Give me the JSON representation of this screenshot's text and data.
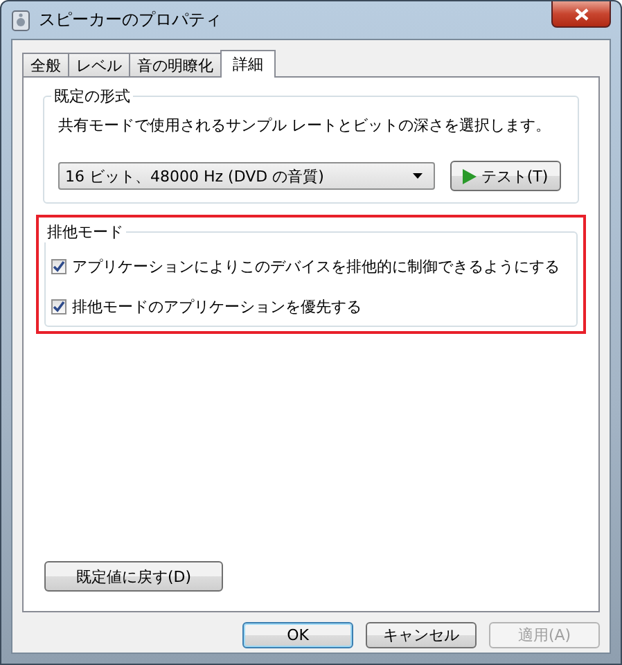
{
  "window": {
    "title": "スピーカーのプロパティ"
  },
  "tabs": [
    {
      "label": "全般",
      "selected": false
    },
    {
      "label": "レベル",
      "selected": false
    },
    {
      "label": "音の明瞭化",
      "selected": false
    },
    {
      "label": "詳細",
      "selected": true
    }
  ],
  "default_format": {
    "title": "既定の形式",
    "description": "共有モードで使用されるサンプル レートとビットの深さを選択します。",
    "dropdown_value": "16 ビット、48000 Hz (DVD の音質)",
    "test_button": "テスト(T)"
  },
  "exclusive_mode": {
    "title": "排他モード",
    "highlighted": true,
    "options": [
      {
        "label": "アプリケーションによりこのデバイスを排他的に制御できるようにする",
        "checked": true
      },
      {
        "label": "排他モードのアプリケーションを優先する",
        "checked": true
      }
    ]
  },
  "restore_button": "既定値に戻す(D)",
  "buttons": [
    {
      "label": "OK",
      "disabled": false,
      "default": true
    },
    {
      "label": "キャンセル",
      "disabled": false,
      "default": false
    },
    {
      "label": "適用(A)",
      "disabled": true,
      "default": false
    }
  ]
}
